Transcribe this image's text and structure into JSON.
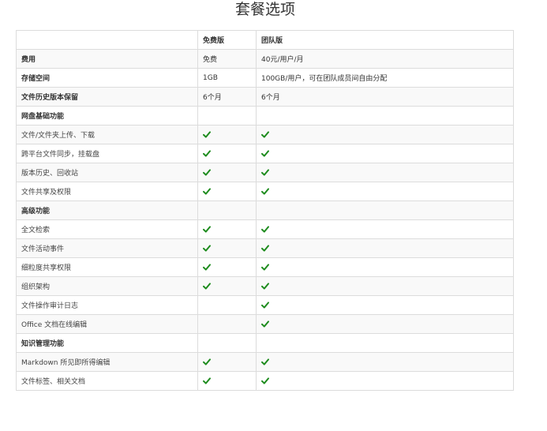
{
  "title": "套餐选项",
  "colors": {
    "check": "#1e8c1e",
    "border": "#dcdcdc",
    "stripe": "#f9f9f9"
  },
  "table": {
    "header": [
      "",
      "免费版",
      "团队版"
    ],
    "rows": [
      {
        "label": "费用",
        "bold": true,
        "free": "免费",
        "team": "40元/用户/月"
      },
      {
        "label": "存储空间",
        "bold": true,
        "free": "1GB",
        "team": "100GB/用户，可在团队成员间自由分配"
      },
      {
        "label": "文件历史版本保留",
        "bold": true,
        "free": "6个月",
        "team": "6个月"
      },
      {
        "label": "网盘基础功能",
        "bold": true,
        "free": "",
        "team": ""
      },
      {
        "label": "文件/文件夹上传、下载",
        "bold": false,
        "free": "check-icon",
        "team": "check-icon"
      },
      {
        "label": "跨平台文件同步，挂载盘",
        "bold": false,
        "free": "check-icon",
        "team": "check-icon"
      },
      {
        "label": "版本历史、回收站",
        "bold": false,
        "free": "check-icon",
        "team": "check-icon"
      },
      {
        "label": "文件共享及权限",
        "bold": false,
        "free": "check-icon",
        "team": "check-icon"
      },
      {
        "label": "高级功能",
        "bold": true,
        "free": "",
        "team": ""
      },
      {
        "label": "全文检索",
        "bold": false,
        "free": "check-icon",
        "team": "check-icon"
      },
      {
        "label": "文件活动事件",
        "bold": false,
        "free": "check-icon",
        "team": "check-icon"
      },
      {
        "label": "细粒度共享权限",
        "bold": false,
        "free": "check-icon",
        "team": "check-icon"
      },
      {
        "label": "组织架构",
        "bold": false,
        "free": "check-icon",
        "team": "check-icon"
      },
      {
        "label": "文件操作审计日志",
        "bold": false,
        "free": "",
        "team": "check-icon"
      },
      {
        "label": "Office 文档在线编辑",
        "bold": false,
        "free": "",
        "team": "check-icon"
      },
      {
        "label": "知识管理功能",
        "bold": true,
        "free": "",
        "team": ""
      },
      {
        "label": "Markdown 所见即所得编辑",
        "bold": false,
        "free": "check-icon",
        "team": "check-icon"
      },
      {
        "label": "文件标签、相关文档",
        "bold": false,
        "free": "check-icon",
        "team": "check-icon"
      }
    ]
  }
}
